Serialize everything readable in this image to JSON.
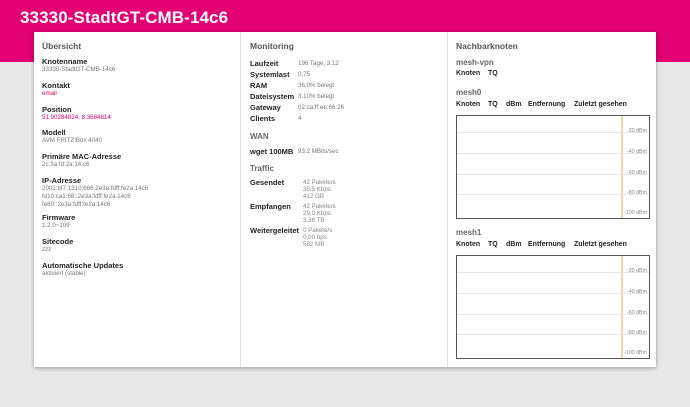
{
  "header": {
    "title": "33330-StadtGT-CMB-14c6"
  },
  "overview": {
    "heading": "Übersicht",
    "node_name_label": "Knotenname",
    "node_name": "33330-StadtGT-CMB-14c6",
    "contact_label": "Kontakt",
    "contact": "email",
    "position_label": "Position",
    "position": "51.90284824, 8.3684814",
    "model_label": "Modell",
    "model": "AVM FRITZ!Box 4040",
    "mac_label": "Primäre MAC-Adresse",
    "mac": "2c:3a:fd:2a:14:c6",
    "ip_label": "IP-Adresse",
    "ips": [
      "2001:bf7:1310:666:2e3a:fdff:fe2a:14c6",
      "fd10:ca1:66::2e3a:fdff:fe2a:14c6",
      "fe80::2e3a:fdff:fe2a:14c6"
    ],
    "firmware_label": "Firmware",
    "firmware": "1.2.0~109",
    "sitecode_label": "Sitecode",
    "sitecode": "zzz",
    "updates_label": "Automatische Updates",
    "updates": "aktiviert (stable)"
  },
  "monitoring": {
    "heading": "Monitoring",
    "rows": [
      {
        "label": "Laufzeit",
        "value": "196 Tage, 3:12"
      },
      {
        "label": "Systemlast",
        "value": "0,75"
      },
      {
        "label": "RAM",
        "value": "36,0% belegt"
      },
      {
        "label": "Dateisystem",
        "value": "3,10% belegt"
      },
      {
        "label": "Gateway",
        "value": "02:ca:ff:ee:66:26"
      },
      {
        "label": "Clients",
        "value": "4"
      }
    ],
    "wan_heading": "WAN",
    "wan_label": "wget 100MB",
    "wan_value": "93.2 MBits/sec",
    "traffic_heading": "Traffic",
    "traffic": [
      {
        "label": "Gesendet",
        "lines": [
          "42 Pakete/s",
          "35,5 Kbps",
          "412 GB"
        ]
      },
      {
        "label": "Empfangen",
        "lines": [
          "42 Pakete/s",
          "29,0 Kbps",
          "3,36 TB"
        ]
      },
      {
        "label": "Weitergeleitet",
        "lines": [
          "0 Pakete/s",
          "0,00 bps",
          "582 MB"
        ]
      }
    ]
  },
  "neighbors": {
    "heading": "Nachbarknoten",
    "mesh_vpn": {
      "title": "mesh-vpn",
      "col_node": "Knoten",
      "col_tq": "TQ"
    },
    "columns": [
      "Knoten",
      "TQ",
      "dBm",
      "Entfernung",
      "Zuletzt gesehen"
    ],
    "mesh0": {
      "title": "mesh0"
    },
    "mesh1": {
      "title": "mesh1"
    },
    "ticks": [
      "-20 dBm",
      "-40 dBm",
      "-60 dBm",
      "-80 dBm",
      "-100 dBm"
    ]
  }
}
